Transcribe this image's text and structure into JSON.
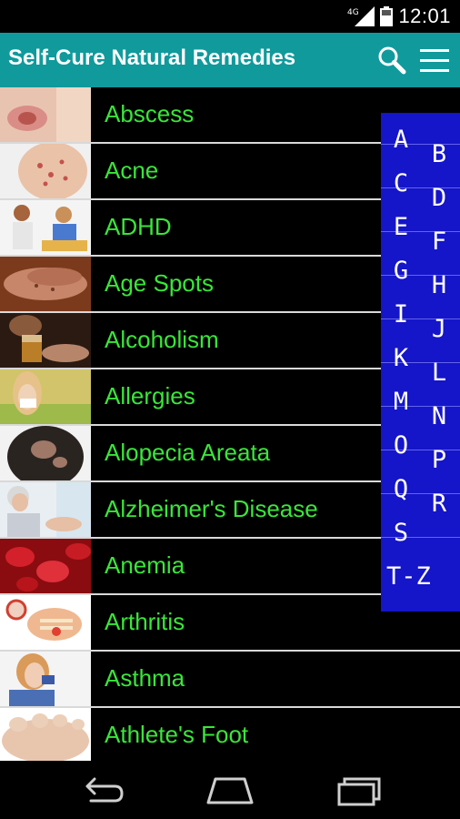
{
  "status_bar": {
    "network": "4G",
    "time": "12:01"
  },
  "action_bar": {
    "title": "Self-Cure Natural Remedies",
    "icons": [
      "search-icon",
      "menu-icon"
    ]
  },
  "list": {
    "items": [
      {
        "label": "Abscess",
        "thumbnail": "abscess-image"
      },
      {
        "label": "Acne",
        "thumbnail": "acne-image"
      },
      {
        "label": "ADHD",
        "thumbnail": "adhd-image"
      },
      {
        "label": "Age Spots",
        "thumbnail": "age-spots-image"
      },
      {
        "label": "Alcoholism",
        "thumbnail": "alcoholism-image"
      },
      {
        "label": "Allergies",
        "thumbnail": "allergies-image"
      },
      {
        "label": "Alopecia Areata",
        "thumbnail": "alopecia-image"
      },
      {
        "label": "Alzheimer's Disease",
        "thumbnail": "alzheimers-image"
      },
      {
        "label": "Anemia",
        "thumbnail": "anemia-image"
      },
      {
        "label": "Arthritis",
        "thumbnail": "arthritis-image"
      },
      {
        "label": "Asthma",
        "thumbnail": "asthma-image"
      },
      {
        "label": "Athlete's Foot",
        "thumbnail": "athletes-foot-image"
      }
    ]
  },
  "alpha_index": {
    "left_column": [
      "A",
      "C",
      "E",
      "G",
      "I",
      "K",
      "M",
      "O",
      "Q",
      "S",
      "T-Z"
    ],
    "right_column": [
      "B",
      "D",
      "F",
      "H",
      "J",
      "L",
      "N",
      "P",
      "R"
    ]
  },
  "nav_bar": {
    "icons": [
      "back-icon",
      "home-icon",
      "recent-apps-icon"
    ]
  },
  "colors": {
    "action_bar": "#109a9c",
    "item_text": "#39e639",
    "index_background": "#1515c9",
    "divider": "#d9d9d9"
  }
}
